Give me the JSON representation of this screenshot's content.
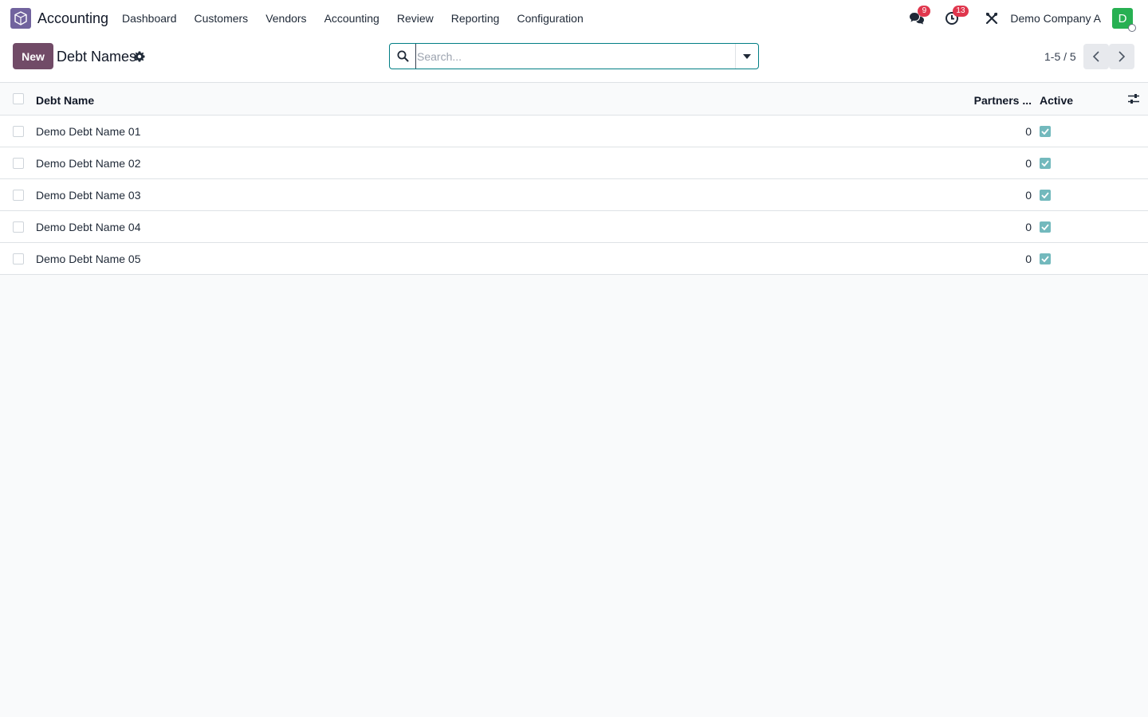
{
  "navbar": {
    "app_name": "Accounting",
    "app_icon": "accounting-app-icon",
    "menu": [
      "Dashboard",
      "Customers",
      "Vendors",
      "Accounting",
      "Review",
      "Reporting",
      "Configuration"
    ],
    "messages_badge": "9",
    "activities_badge": "13",
    "company": "Demo Company A",
    "avatar_initial": "D",
    "avatar_color": "#27b052"
  },
  "control_panel": {
    "new_label": "New",
    "title": "Debt Names",
    "search_placeholder": "Search...",
    "pager": "1-5 / 5"
  },
  "table": {
    "columns": [
      "Debt Name",
      "Partners ...",
      "Active"
    ],
    "rows": [
      {
        "name": "Demo Debt Name 01",
        "partners": "0",
        "active": true
      },
      {
        "name": "Demo Debt Name 02",
        "partners": "0",
        "active": true
      },
      {
        "name": "Demo Debt Name 03",
        "partners": "0",
        "active": true
      },
      {
        "name": "Demo Debt Name 04",
        "partners": "0",
        "active": true
      },
      {
        "name": "Demo Debt Name 05",
        "partners": "0",
        "active": true
      }
    ]
  },
  "colors": {
    "primary": "#714b67",
    "accent": "#017e84",
    "badge": "#e0364d",
    "checkbox_checked": "#73b9bd"
  }
}
